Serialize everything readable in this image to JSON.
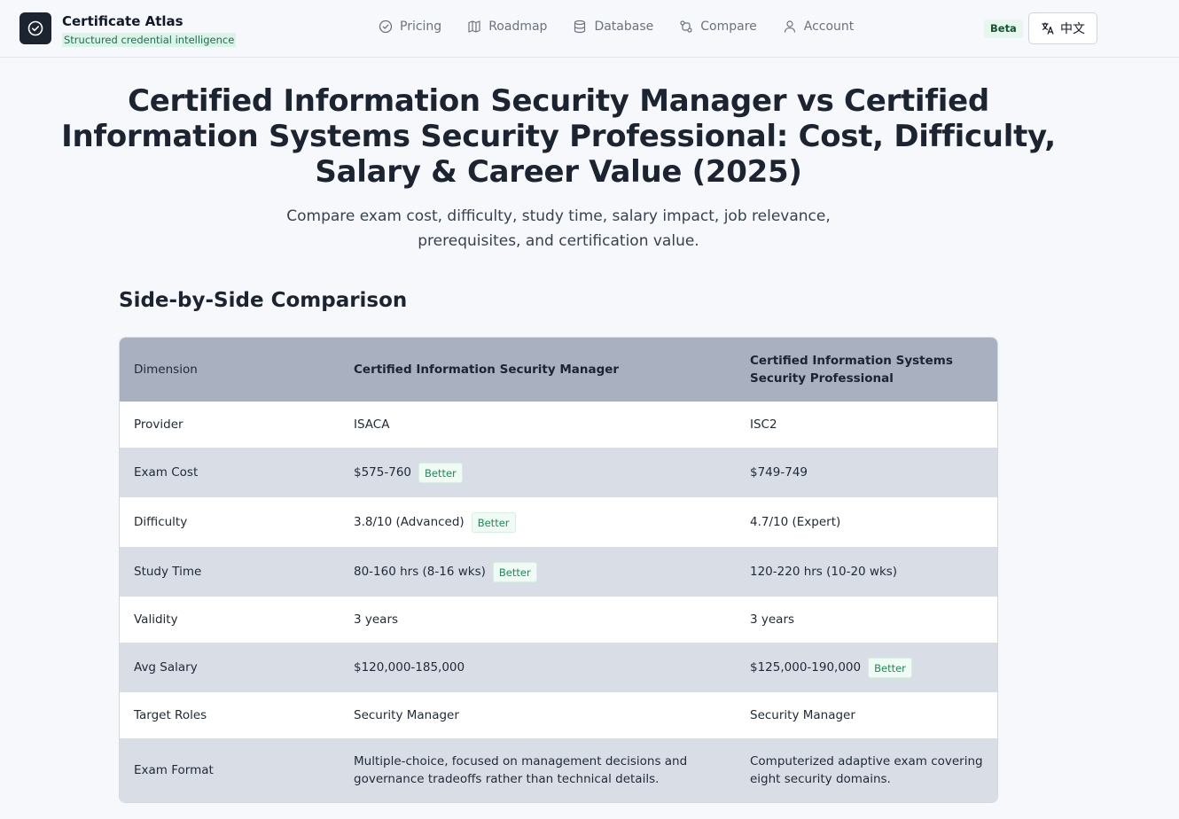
{
  "header": {
    "brand_name": "Certificate Atlas",
    "brand_tagline": "Structured credential intelligence",
    "nav": [
      {
        "label": "Pricing",
        "icon": "check-circle-icon"
      },
      {
        "label": "Roadmap",
        "icon": "map-icon"
      },
      {
        "label": "Database",
        "icon": "database-icon"
      },
      {
        "label": "Compare",
        "icon": "compare-icon"
      },
      {
        "label": "Account",
        "icon": "user-icon"
      }
    ],
    "beta_label": "Beta",
    "language_label": "中文"
  },
  "hero": {
    "title": "Certified Information Security Manager vs Certified Information Systems Security Professional: Cost, Difficulty, Salary & Career Value (2025)",
    "subtitle": "Compare exam cost, difficulty, study time, salary impact, job relevance, prerequisites, and certification value."
  },
  "comparison": {
    "section_title": "Side-by-Side Comparison",
    "better_label": "Better",
    "columns": [
      "Dimension",
      "Certified Information Security Manager",
      "Certified Information Systems Security Professional"
    ],
    "rows": [
      {
        "dimension": "Provider",
        "a": "ISACA",
        "b": "ISC2",
        "better": ""
      },
      {
        "dimension": "Exam Cost",
        "a": "$575-760",
        "b": "$749-749",
        "better": "a"
      },
      {
        "dimension": "Difficulty",
        "a": "3.8/10 (Advanced)",
        "b": "4.7/10 (Expert)",
        "better": "a"
      },
      {
        "dimension": "Study Time",
        "a": "80-160 hrs (8-16 wks)",
        "b": "120-220 hrs (10-20 wks)",
        "better": "a"
      },
      {
        "dimension": "Validity",
        "a": "3 years",
        "b": "3 years",
        "better": ""
      },
      {
        "dimension": "Avg Salary",
        "a": "$120,000-185,000",
        "b": "$125,000-190,000",
        "better": "b"
      },
      {
        "dimension": "Target Roles",
        "a": "Security Manager",
        "b": "Security Manager",
        "better": ""
      },
      {
        "dimension": "Exam Format",
        "a": "Multiple-choice, focused on management decisions and governance tradeoffs rather than technical details.",
        "b": "Computerized adaptive exam covering eight security domains.",
        "better": ""
      }
    ]
  }
}
